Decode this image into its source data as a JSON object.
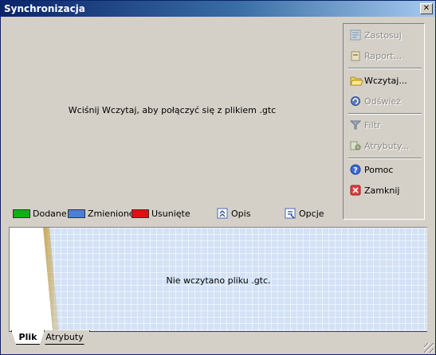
{
  "window": {
    "title": "Synchronizacja",
    "close_label": "✕"
  },
  "message": "Wciśnij Wczytaj, aby połączyć się z plikiem .gtc",
  "panel": {
    "items": [
      {
        "label": "Zastosuj",
        "icon": "apply-icon",
        "enabled": false
      },
      {
        "label": "Raport...",
        "icon": "report-icon",
        "enabled": false
      },
      {
        "label": "Wczytaj...",
        "icon": "folder-open-icon",
        "enabled": true
      },
      {
        "label": "Odśwież",
        "icon": "refresh-icon",
        "enabled": false
      },
      {
        "label": "Filtr",
        "icon": "filter-icon",
        "enabled": false
      },
      {
        "label": "Atrybuty...",
        "icon": "attributes-icon",
        "enabled": false
      },
      {
        "label": "Pomoc",
        "icon": "help-icon",
        "enabled": true
      },
      {
        "label": "Zamknij",
        "icon": "close-icon",
        "enabled": true
      }
    ]
  },
  "legend": {
    "added": {
      "label": "Dodane",
      "color": "#10b010"
    },
    "changed": {
      "label": "Zmienione",
      "color": "#4a7fd8"
    },
    "removed": {
      "label": "Usunięte",
      "color": "#e01010"
    },
    "description": "Opis",
    "options": "Opcje"
  },
  "preview": {
    "message": "Nie wczytano pliku .gtc."
  },
  "tabs": [
    {
      "label": "Plik",
      "active": true
    },
    {
      "label": "Atrybuty",
      "active": false
    }
  ]
}
